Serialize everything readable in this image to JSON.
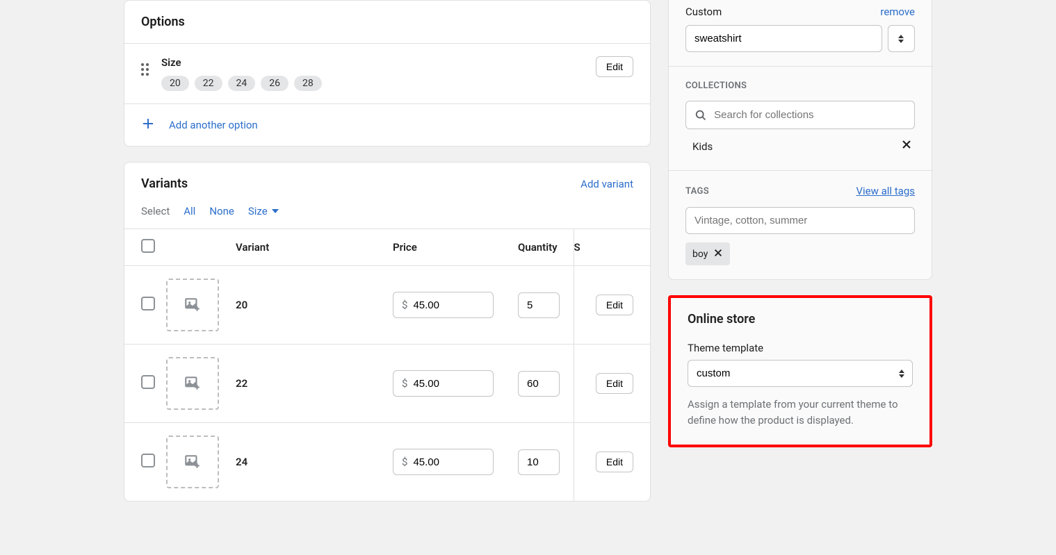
{
  "options_card": {
    "title": "Options",
    "option": {
      "name": "Size",
      "values": [
        "20",
        "22",
        "24",
        "26",
        "28"
      ],
      "edit_label": "Edit"
    },
    "add_another_label": "Add another option"
  },
  "variants_card": {
    "title": "Variants",
    "add_variant_label": "Add variant",
    "select_label": "Select",
    "filter_all": "All",
    "filter_none": "None",
    "filter_size": "Size",
    "columns": {
      "variant": "Variant",
      "price": "Price",
      "quantity": "Quantity",
      "sku": "S"
    },
    "price_prefix": "$",
    "edit_label": "Edit",
    "rows": [
      {
        "variant": "20",
        "price": "45.00",
        "quantity": "5"
      },
      {
        "variant": "22",
        "price": "45.00",
        "quantity": "60"
      },
      {
        "variant": "24",
        "price": "45.00",
        "quantity": "10"
      }
    ]
  },
  "sidebar": {
    "custom": {
      "label": "Custom",
      "remove_label": "remove",
      "value": "sweatshirt"
    },
    "collections": {
      "title": "COLLECTIONS",
      "placeholder": "Search for collections",
      "items": [
        {
          "name": "Kids"
        }
      ]
    },
    "tags": {
      "title": "TAGS",
      "view_all_label": "View all tags",
      "placeholder": "Vintage, cotton, summer",
      "items": [
        {
          "name": "boy"
        }
      ]
    },
    "online_store": {
      "title": "Online store",
      "template_label": "Theme template",
      "template_value": "custom",
      "help_text": "Assign a template from your current theme to define how the product is displayed."
    }
  }
}
